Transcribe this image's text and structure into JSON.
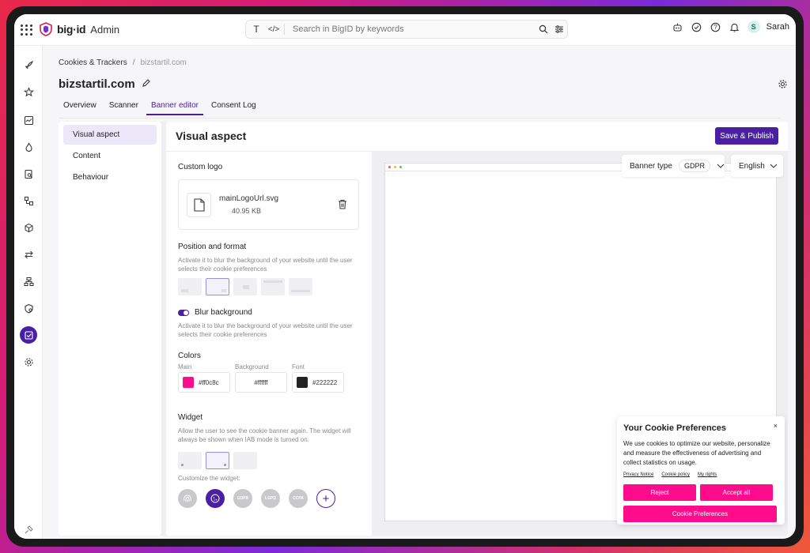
{
  "app": {
    "brand": "big·id",
    "sub": "Admin"
  },
  "search": {
    "placeholder": "Search in BigID by keywords"
  },
  "user": {
    "initial": "S",
    "name": "Sarah"
  },
  "breadcrumb": {
    "parent": "Cookies & Trackers",
    "current": "bizstartil.com"
  },
  "page": {
    "title": "bizstartil.com"
  },
  "tabs": [
    {
      "label": "Overview",
      "active": false
    },
    {
      "label": "Scanner",
      "active": false
    },
    {
      "label": "Banner editor",
      "active": true
    },
    {
      "label": "Consent Log",
      "active": false
    }
  ],
  "sidebar": {
    "items": [
      {
        "label": "Visual aspect",
        "active": true
      },
      {
        "label": "Content",
        "active": false
      },
      {
        "label": "Behaviour",
        "active": false
      }
    ]
  },
  "main": {
    "title": "Visual aspect",
    "publish_label": "Save & Publish"
  },
  "custom_logo": {
    "heading": "Custom logo",
    "file_name": "mainLogoUrl.svg",
    "file_size": "40.95 KB"
  },
  "position": {
    "heading": "Position and format",
    "desc": "Activate it to blur the background of your website until the user selects their cookie preferences",
    "selected_index": 1
  },
  "blur": {
    "label": "Blur background",
    "enabled": true,
    "desc": "Activate it to blur the background of your website until the user selects their cookie preferences"
  },
  "colors": {
    "heading": "Colors",
    "main_label": "Main",
    "main_value": "#ff0c8c",
    "background_label": "Background",
    "background_value": "#ffffff",
    "font_label": "Font",
    "font_value": "#222222"
  },
  "widget": {
    "heading": "Widget",
    "desc": "Allow the user to see the cookie banner again. The widget will always be shown when IAB mode is turned on.",
    "customize_label": "Customize the widget:",
    "badges": [
      "GDPR",
      "LGPD",
      "CCPA"
    ],
    "selected_index": 1
  },
  "preview": {
    "banner_type_label": "Banner type",
    "banner_type_value": "GDPR",
    "language": "English"
  },
  "cookie_banner": {
    "title": "Your Cookie Preferences",
    "close": "×",
    "text": "We use cookies to optimize our website, personalize and measure the effectiveness of advertising and collect statistics on usage.",
    "links": [
      "Privacy Notice",
      "Cookie policy",
      "My rights"
    ],
    "reject": "Reject",
    "accept": "Accept all",
    "preferences": "Cookie Preferences"
  },
  "theme": {
    "accent": "#4b1fa3",
    "cookie_accent": "#ff0c8c"
  }
}
